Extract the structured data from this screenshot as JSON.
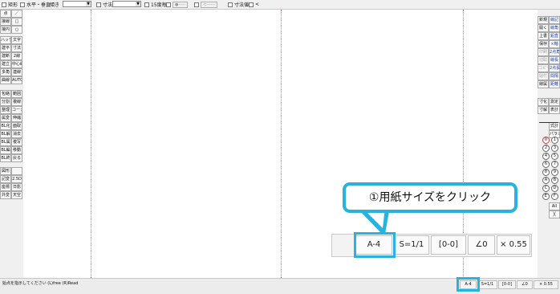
{
  "toolbar": {
    "rect_label": "矩形",
    "horiz_vert_label": "水平・垂直",
    "slope_label": "傾き",
    "dim_label": "寸法",
    "deg15_label": "15度毎",
    "btn_circle": "●-----",
    "btn_dash": "<------",
    "dim_value_label": "寸法値",
    "arrow_label": "<"
  },
  "left_tools": [
    [
      "点",
      "／"
    ],
    [
      "接線",
      "□"
    ],
    [
      "接円",
      "○"
    ],
    [
      "ハッチ",
      "文字"
    ],
    [
      "建平",
      "寸法"
    ],
    [
      "建断",
      "2線"
    ],
    [
      "建立",
      "中心線"
    ],
    [
      "多角",
      "連線"
    ],
    [
      "曲線",
      "AUTO"
    ],
    [
      "包絡",
      "範囲"
    ],
    [
      "分割",
      "複線"
    ],
    [
      "整理",
      "コーナー"
    ],
    [
      "属変",
      "伸縮"
    ],
    [
      "BL化",
      "面取"
    ],
    [
      "BL解",
      "消去"
    ],
    [
      "BL属",
      "複写"
    ],
    [
      "BL編",
      "移動"
    ],
    [
      "BL終",
      "戻る"
    ],
    [
      "図形",
      ""
    ],
    [
      "記変",
      "2.5D"
    ],
    [
      "座標",
      "日影"
    ],
    [
      "外変",
      "天空"
    ]
  ],
  "right_tools": [
    [
      "新規",
      "線記"
    ],
    [
      "開く",
      "線角"
    ],
    [
      "上書",
      "鉛直"
    ],
    [
      "保存",
      "×軸"
    ],
    [
      "印刷",
      "2点角"
    ],
    [
      "切取",
      "線長"
    ],
    [
      "コピー",
      "2点長"
    ],
    [
      "貼付",
      "間隔"
    ],
    [
      "線属",
      "距離"
    ]
  ],
  "right_tools2": [
    [
      "寸化",
      "測定"
    ],
    [
      "寸解",
      "表計"
    ],
    [
      "",
      ""
    ],
    [
      "",
      "式計"
    ],
    [
      "",
      "パラメ"
    ]
  ],
  "layer_rows": [
    [
      "0",
      "1"
    ],
    [
      "2",
      "3"
    ],
    [
      "4",
      "5"
    ],
    [
      "6",
      "7"
    ],
    [
      "8",
      "9"
    ],
    [
      "A",
      "B"
    ],
    [
      "C",
      "D"
    ],
    [
      "E",
      "F"
    ]
  ],
  "layer_all": "All",
  "status": {
    "message": "始点を指示してください (L)free (R)Read",
    "paper": "A-4",
    "scale": "S=1/1",
    "layer": "[0-0]",
    "angle": "∠0",
    "zoom": "× 0.55"
  },
  "zoom_status": {
    "paper": "A-4",
    "scale": "S=1/1",
    "layer": "[0-0]",
    "angle": "∠0",
    "zoom": "× 0.55"
  },
  "callout": {
    "text": "①用紙サイズをクリック"
  },
  "colors": {
    "accent": "#27b3e0",
    "guide_line": "#d27ad2",
    "command_text": "#1a3fa8"
  }
}
